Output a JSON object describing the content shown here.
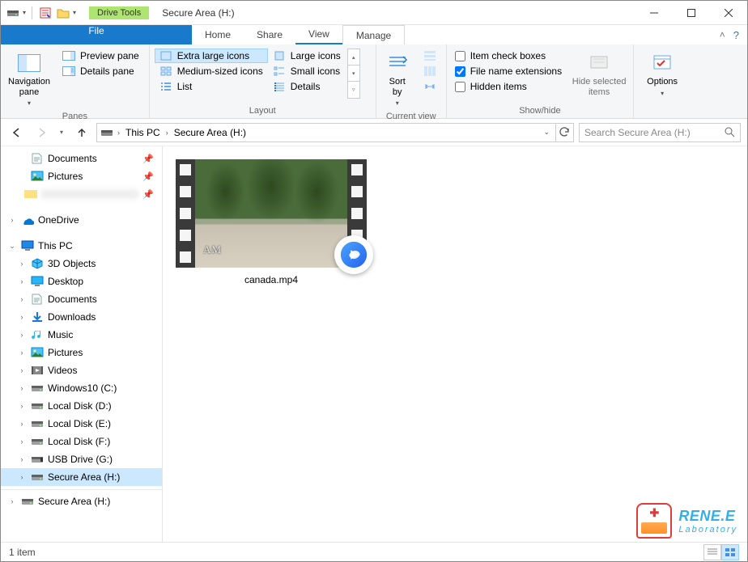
{
  "window": {
    "tool_tab_label": "Drive Tools",
    "title": "Secure Area (H:)"
  },
  "tabs": {
    "file": "File",
    "home": "Home",
    "share": "Share",
    "view": "View",
    "manage": "Manage"
  },
  "ribbon": {
    "panes": {
      "nav": "Navigation\npane",
      "preview": "Preview pane",
      "details": "Details pane",
      "group": "Panes"
    },
    "layout": {
      "xl": "Extra large icons",
      "large": "Large icons",
      "medium": "Medium-sized icons",
      "small": "Small icons",
      "list": "List",
      "details": "Details",
      "group": "Layout"
    },
    "current": {
      "sort": "Sort\nby",
      "group": "Current view"
    },
    "showhide": {
      "item_check": "Item check boxes",
      "ext": "File name extensions",
      "hidden": "Hidden items",
      "hide_sel": "Hide selected\nitems",
      "group": "Show/hide"
    },
    "options": "Options"
  },
  "address": {
    "root": "This PC",
    "loc": "Secure Area (H:)",
    "search_placeholder": "Search Secure Area (H:)"
  },
  "tree": {
    "quick": [
      {
        "label": "Documents",
        "icon": "doc"
      },
      {
        "label": "Pictures",
        "icon": "pic"
      },
      {
        "label": "",
        "icon": "blur"
      }
    ],
    "onedrive": "OneDrive",
    "thispc": "This PC",
    "pc_items": [
      {
        "label": "3D Objects",
        "icon": "3d"
      },
      {
        "label": "Desktop",
        "icon": "desktop"
      },
      {
        "label": "Documents",
        "icon": "doc"
      },
      {
        "label": "Downloads",
        "icon": "down"
      },
      {
        "label": "Music",
        "icon": "music"
      },
      {
        "label": "Pictures",
        "icon": "pic"
      },
      {
        "label": "Videos",
        "icon": "vid"
      },
      {
        "label": "Windows10 (C:)",
        "icon": "drive"
      },
      {
        "label": "Local Disk (D:)",
        "icon": "drive"
      },
      {
        "label": "Local Disk (E:)",
        "icon": "drive"
      },
      {
        "label": "Local Disk (F:)",
        "icon": "drive"
      },
      {
        "label": "USB Drive (G:)",
        "icon": "usb"
      },
      {
        "label": "Secure Area (H:)",
        "icon": "drive",
        "selected": true
      }
    ],
    "below": {
      "label": "Secure Area (H:)",
      "icon": "drive"
    }
  },
  "content": {
    "file_name": "canada.mp4",
    "watermark": "AM"
  },
  "status": {
    "count": "1 item"
  },
  "logo": {
    "line1": "RENE.E",
    "line2": "Laboratory"
  }
}
